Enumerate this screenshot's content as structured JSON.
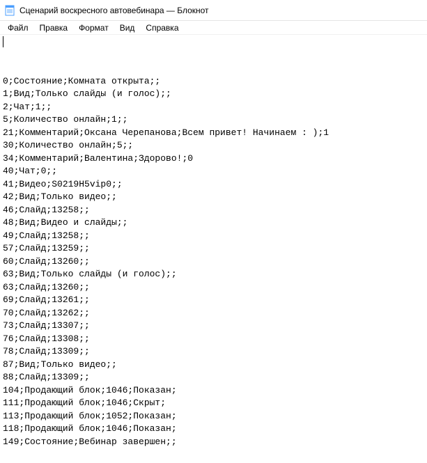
{
  "titlebar": {
    "title": "Сценарий воскресного автовебинара — Блокнот"
  },
  "menubar": {
    "file": "Файл",
    "edit": "Правка",
    "format": "Формат",
    "view": "Вид",
    "help": "Справка"
  },
  "content": {
    "lines": [
      "0;Состояние;Комната открыта;;",
      "1;Вид;Только слайды (и голос);;",
      "2;Чат;1;;",
      "5;Количество онлайн;1;;",
      "21;Комментарий;Оксана Черепанова;Всем привет! Начинаем : );1",
      "30;Количество онлайн;5;;",
      "34;Комментарий;Валентина;Здорово!;0",
      "40;Чат;0;;",
      "41;Видео;S0219H5vip0;;",
      "42;Вид;Только видео;;",
      "46;Слайд;13258;;",
      "48;Вид;Видео и слайды;;",
      "49;Слайд;13258;;",
      "57;Слайд;13259;;",
      "60;Слайд;13260;;",
      "63;Вид;Только слайды (и голос);;",
      "63;Слайд;13260;;",
      "69;Слайд;13261;;",
      "70;Слайд;13262;;",
      "73;Слайд;13307;;",
      "76;Слайд;13308;;",
      "78;Слайд;13309;;",
      "87;Вид;Только видео;;",
      "88;Слайд;13309;;",
      "104;Продающий блок;1046;Показан;",
      "111;Продающий блок;1046;Скрыт;",
      "113;Продающий блок;1052;Показан;",
      "118;Продающий блок;1046;Показан;",
      "149;Состояние;Вебинар завершен;;"
    ]
  }
}
